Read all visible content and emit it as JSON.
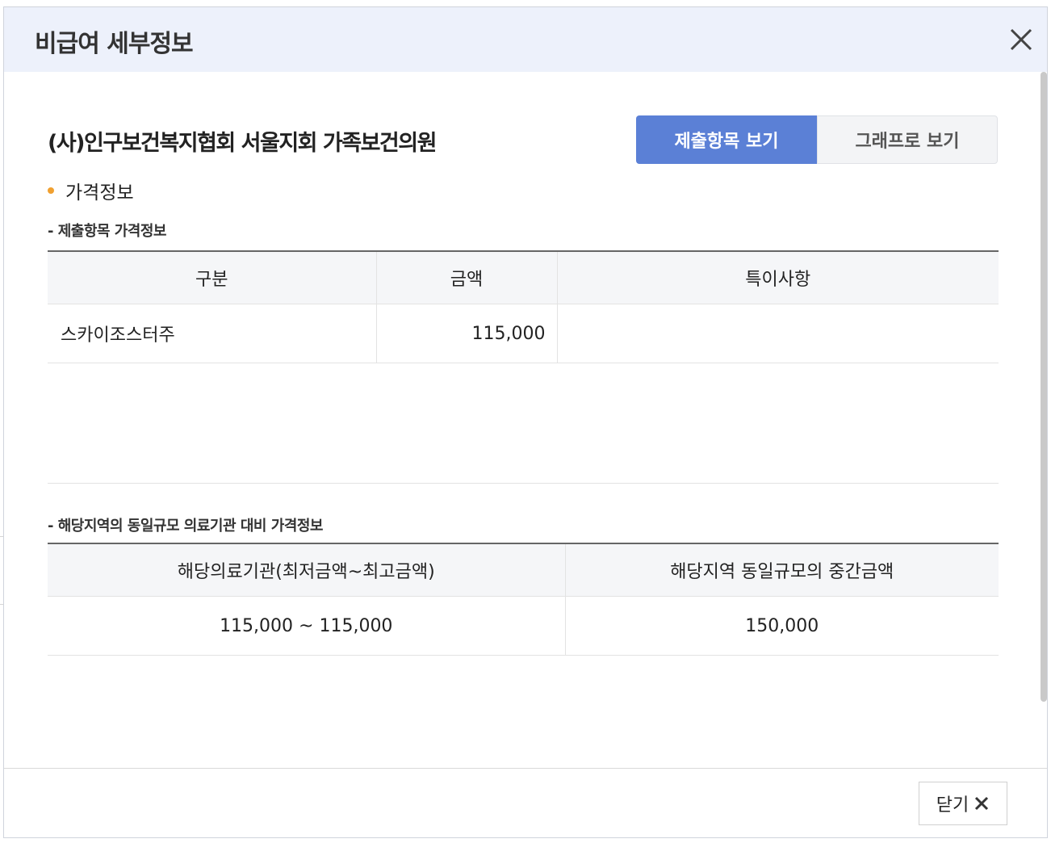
{
  "dialog": {
    "title": "비급여 세부정보",
    "close_icon": "close-icon"
  },
  "institution": {
    "name": "(사)인구보건복지협회 서울지회 가족보건의원"
  },
  "view_tabs": [
    {
      "label": "제출항목 보기",
      "active": true
    },
    {
      "label": "그래프로 보기",
      "active": false
    }
  ],
  "price_info": {
    "section_label": "가격정보",
    "submitted_heading": "- 제출항목 가격정보",
    "submitted_table": {
      "headers": [
        "구분",
        "금액",
        "특이사항"
      ],
      "rows": [
        {
          "category": "스카이조스터주",
          "amount": "115,000",
          "note": ""
        }
      ]
    },
    "regional_heading": "- 해당지역의 동일규모 의료기관 대비 가격정보",
    "regional_table": {
      "headers": [
        "해당의료기관(최저금액~최고금액)",
        "해당지역 동일규모의 중간금액"
      ],
      "rows": [
        {
          "range": "115,000 ~ 115,000",
          "median": "150,000"
        }
      ]
    }
  },
  "footer": {
    "close_label": "닫기"
  },
  "colors": {
    "header_bg": "#edf1fb",
    "active_tab": "#5b80d6",
    "bullet": "#f0a030"
  }
}
